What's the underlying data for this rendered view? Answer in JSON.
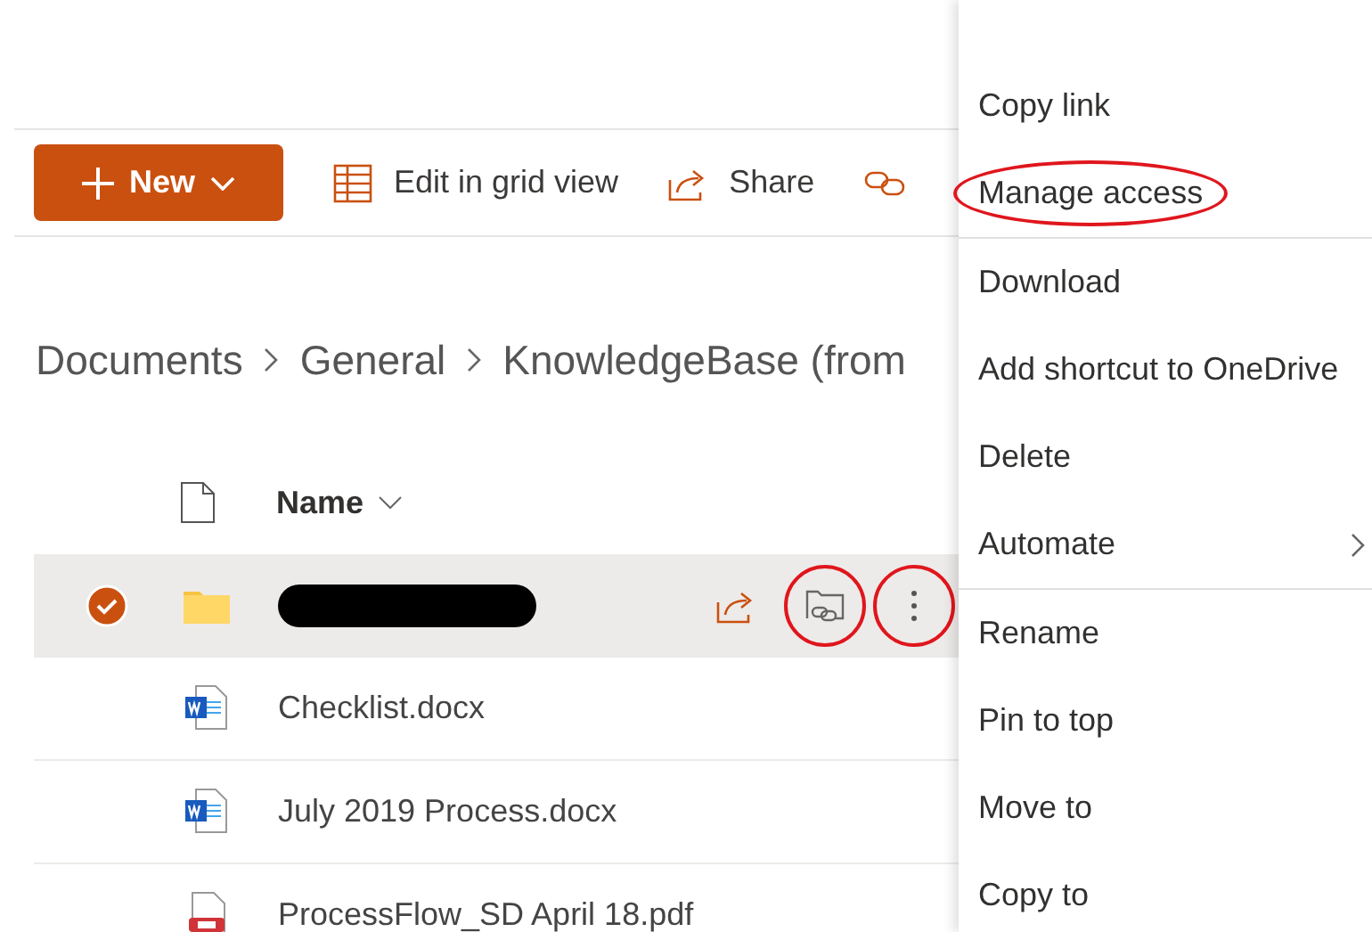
{
  "toolbar": {
    "new_button": {
      "label": "New"
    },
    "items": [
      {
        "kind": "grid",
        "label": "Edit in grid view"
      },
      {
        "kind": "share",
        "label": "Share"
      },
      {
        "kind": "link"
      }
    ]
  },
  "breadcrumb": [
    "Documents",
    "General",
    "KnowledgeBase (from"
  ],
  "list": {
    "columns": [
      {
        "label": "Name"
      }
    ],
    "rows": [
      {
        "kind": "folder",
        "redacted": true,
        "selected": true,
        "actions": [
          {
            "kind": "share",
            "circled": false
          },
          {
            "kind": "manage-access",
            "circled": true
          },
          {
            "kind": "more",
            "circled": true
          }
        ]
      },
      {
        "kind": "word",
        "name": "Checklist.docx",
        "redacted": false,
        "selected": false
      },
      {
        "kind": "word",
        "name": "July 2019 Process.docx",
        "redacted": false,
        "selected": false
      },
      {
        "kind": "pdf",
        "name": "ProcessFlow_SD April 18.pdf",
        "redacted": false,
        "selected": false
      }
    ]
  },
  "context_menu": {
    "sections": [
      [
        {
          "label": "Copy link",
          "submenu": false,
          "circled": false
        },
        {
          "label": "Manage access",
          "submenu": false,
          "circled": true
        }
      ],
      [
        {
          "label": "Download",
          "submenu": false,
          "circled": false
        },
        {
          "label": "Add shortcut to OneDrive",
          "submenu": false,
          "circled": false
        },
        {
          "label": "Delete",
          "submenu": false,
          "circled": false
        },
        {
          "label": "Automate",
          "submenu": true,
          "circled": false
        }
      ],
      [
        {
          "label": "Rename",
          "submenu": false,
          "circled": false
        },
        {
          "label": "Pin to top",
          "submenu": false,
          "circled": false
        },
        {
          "label": "Move to",
          "submenu": false,
          "circled": false
        },
        {
          "label": "Copy to",
          "submenu": false,
          "circled": false
        }
      ]
    ]
  }
}
